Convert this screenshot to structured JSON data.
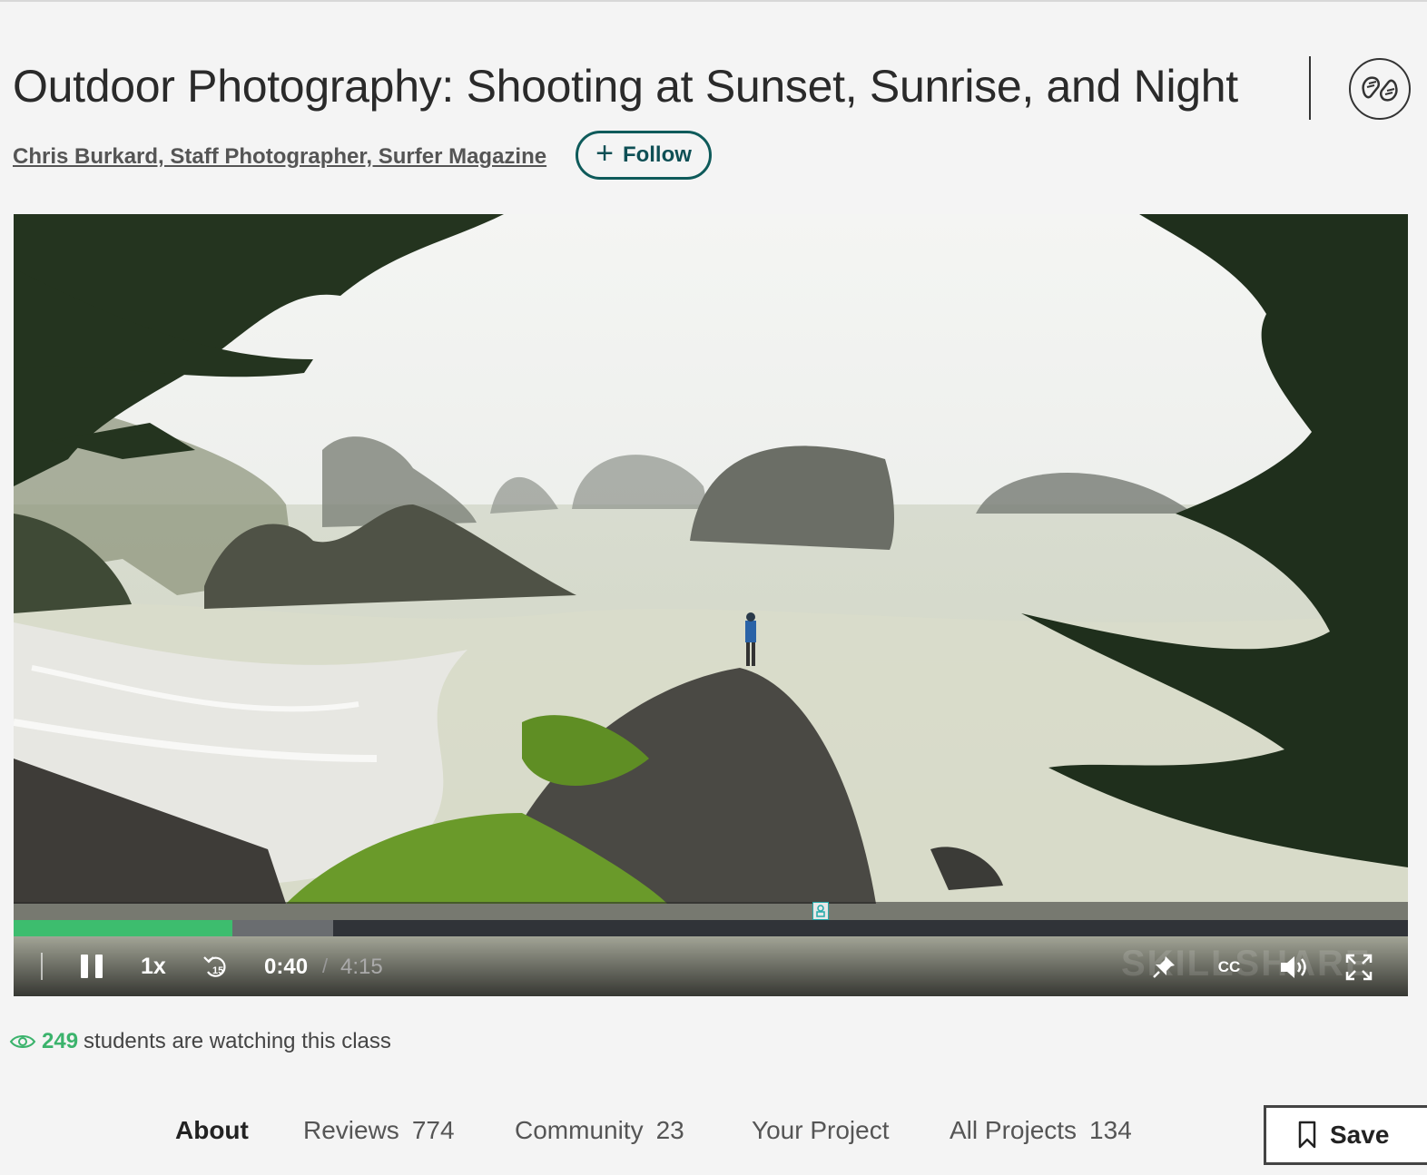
{
  "course": {
    "title": "Outdoor Photography: Shooting at Sunset, Sunrise, and Night",
    "author": "Chris Burkard, Staff Photographer, Surfer Magazine",
    "follow_label": "Follow"
  },
  "player": {
    "speed": "1x",
    "rewind_label": "15",
    "current_time": "0:40",
    "separator": "/",
    "total_time": "4:15",
    "progress_fraction": 0.157,
    "buffered_fraction": 0.229,
    "watermark": "SKILLSHARE",
    "cc_label": "CC",
    "is_playing": true
  },
  "watching": {
    "count": "249",
    "text": "students are watching this class"
  },
  "tabs": [
    {
      "label": "About",
      "count": "",
      "active": true
    },
    {
      "label": "Reviews",
      "count": "774",
      "active": false
    },
    {
      "label": "Community",
      "count": "23",
      "active": false
    },
    {
      "label": "Your Project",
      "count": "",
      "active": false
    },
    {
      "label": "All Projects",
      "count": "134",
      "active": false
    }
  ],
  "save_label": "Save",
  "colors": {
    "accent_green": "#3dbd6e",
    "follow_teal": "#0e5a5a",
    "background": "#f4f4f4"
  }
}
